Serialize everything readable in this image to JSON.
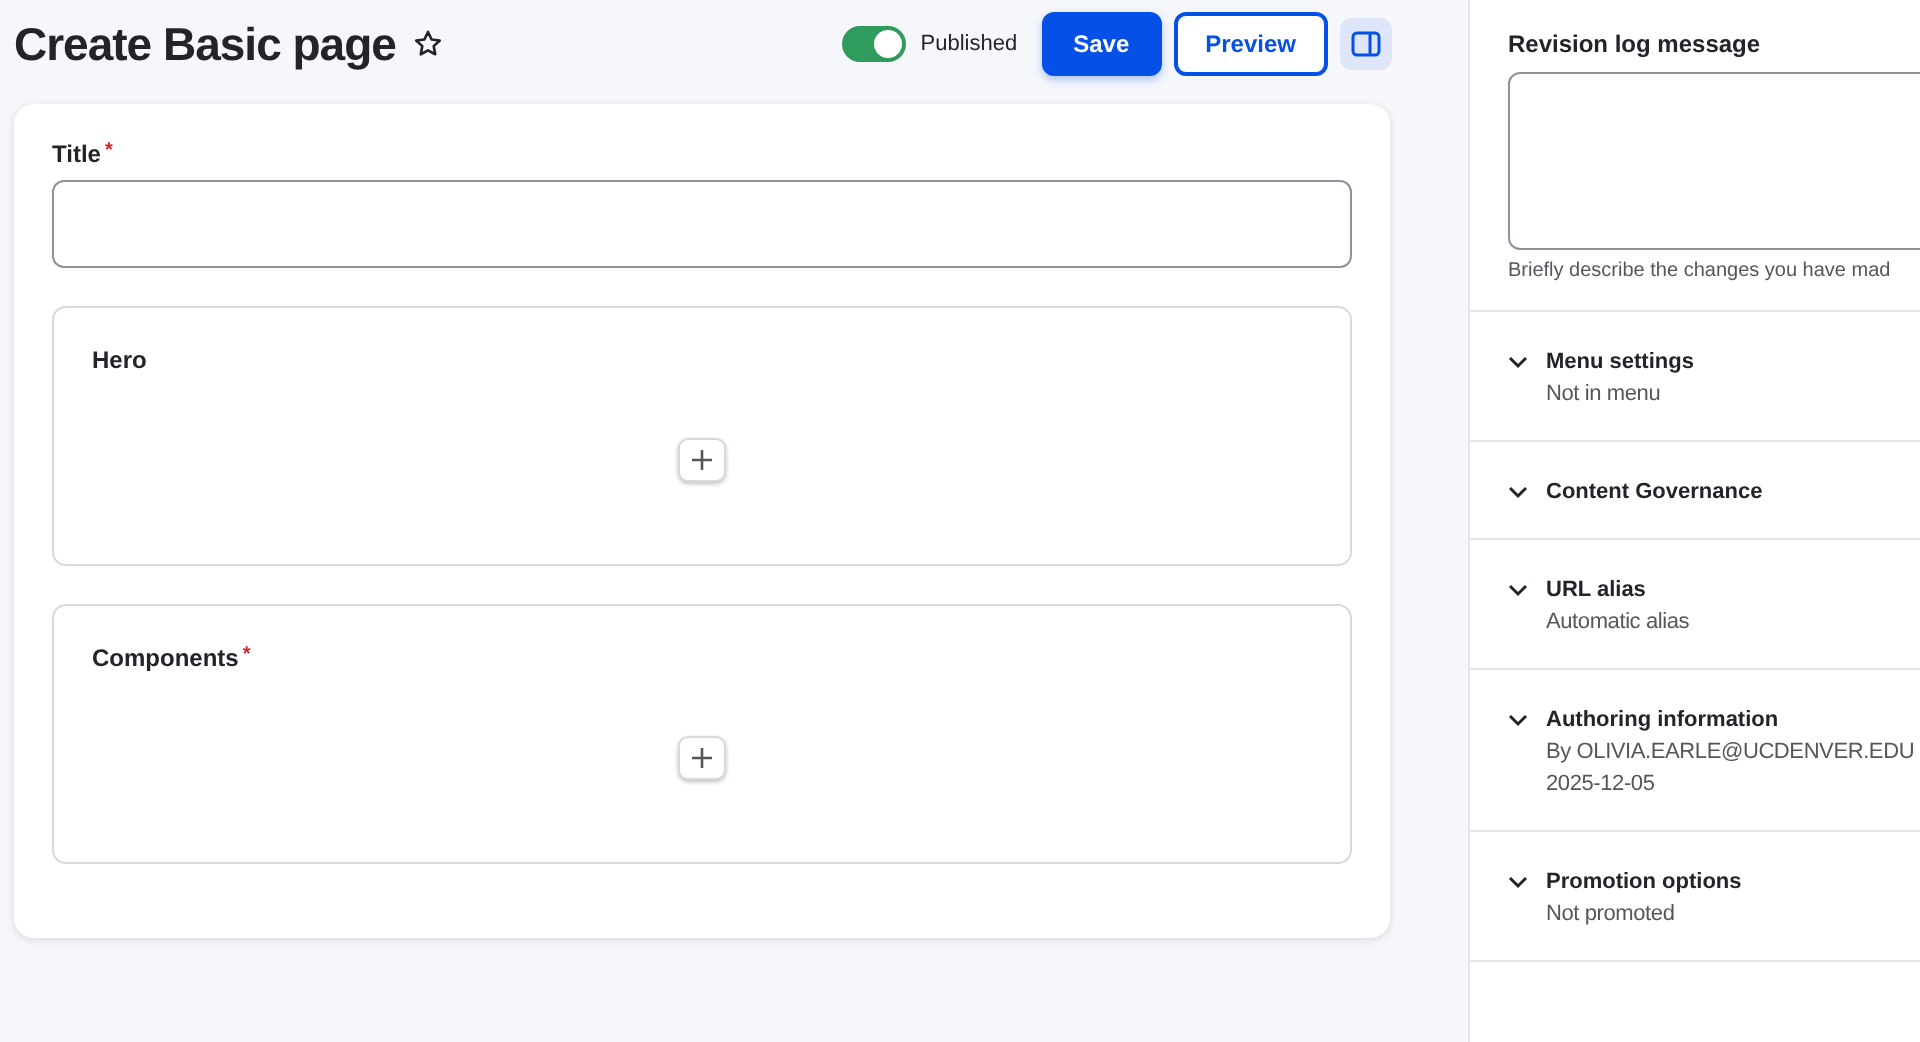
{
  "header": {
    "title": "Create Basic page",
    "favorite": false,
    "published": {
      "label": "Published",
      "on": true
    },
    "buttons": [
      {
        "label": "Save",
        "kind": "primary"
      },
      {
        "label": "Preview",
        "kind": "secondary"
      }
    ]
  },
  "form": {
    "title_field": {
      "label": "Title",
      "required_marker": "*"
    },
    "sections": [
      {
        "label": "Hero"
      },
      {
        "label": "Components",
        "required_marker": "*"
      }
    ]
  },
  "sidebar": {
    "revision": {
      "label": "Revision log message",
      "description": "Briefly describe the changes you have mad"
    },
    "groups": [
      {
        "title": "Menu settings",
        "expanded": false,
        "summary": [
          "Not in menu"
        ]
      },
      {
        "title": "Content Governance",
        "expanded": false
      },
      {
        "title": "URL alias",
        "expanded": false,
        "summary": [
          "Automatic alias"
        ]
      },
      {
        "title": "Authoring information",
        "expanded": false,
        "summary": [
          "By OLIVIA.EARLE@UCDENVER.EDU",
          "2025-12-05"
        ]
      },
      {
        "title": "Promotion options",
        "expanded": false,
        "summary": [
          "Not promoted"
        ]
      }
    ]
  }
}
